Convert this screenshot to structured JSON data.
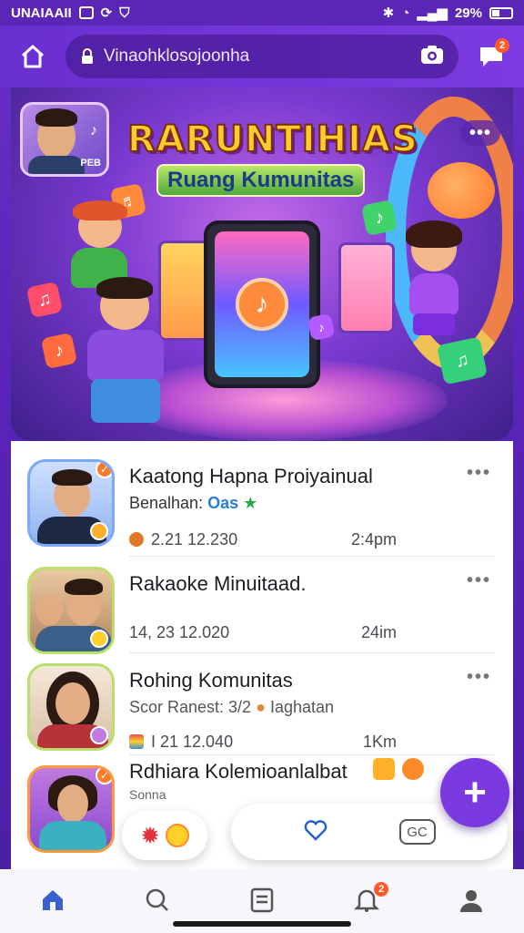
{
  "status_bar": {
    "carrier": "UNAIAAII",
    "battery": "29%"
  },
  "top_bar": {
    "search_text": "Vinaohklosojoonha",
    "notification_count": "2"
  },
  "hero": {
    "title": "RARUNTIHIAS",
    "subtitle": "Ruang Kumunitas",
    "avatar_caption": "PEB"
  },
  "posts": [
    {
      "title": "Kaatong Hapna Proiyainual",
      "sub_prefix": "Benalhan:",
      "sub_highlight": "Oas",
      "meta": "2.21 12.230",
      "time": "2:4pm"
    },
    {
      "title": "Rakaoke Minuitaad.",
      "sub_prefix": "",
      "sub_highlight": "",
      "meta": "14, 23 12.020",
      "time": "24im"
    },
    {
      "title": "Rohing Komunitas",
      "sub_prefix": "Scor Ranest: 3/2",
      "sub_highlight": "Iaghatan",
      "meta": "I 21 12.040",
      "time": "1Km"
    },
    {
      "title": "Rdhiara Kolemioanlalbat",
      "sub_prefix": "Sonna",
      "sub_highlight": "",
      "meta": "",
      "time": ""
    }
  ],
  "reaction_bar": {
    "gc_label": "GC"
  },
  "bottom_nav": {
    "alerts_badge": "2"
  },
  "colors": {
    "brand_purple": "#6a2fd0",
    "accent_orange": "#ff7a2a",
    "link_blue": "#2a7be0"
  }
}
